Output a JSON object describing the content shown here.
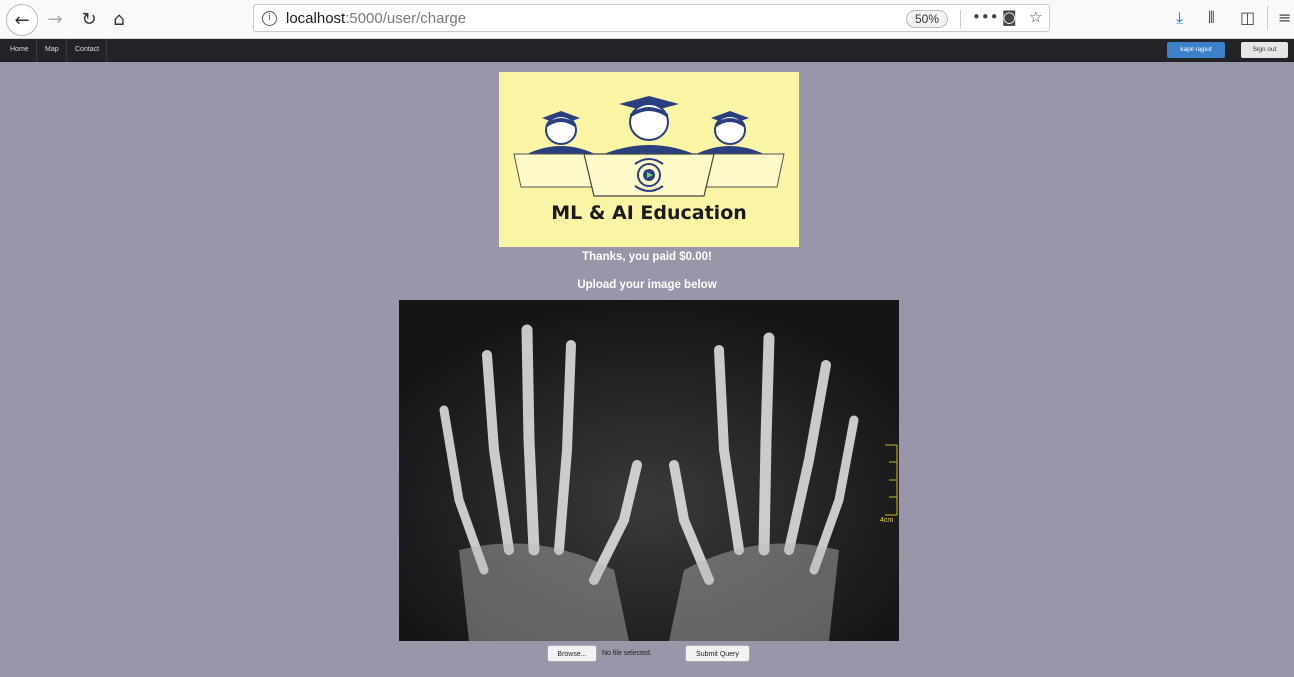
{
  "browser": {
    "url_host": "localhost",
    "url_path": ":5000/user/charge",
    "zoom": "50%"
  },
  "navbar": {
    "links": [
      "Home",
      "Map",
      "Contact"
    ],
    "user_label": "kapil rajput",
    "signout_label": "Sign out"
  },
  "logo": {
    "text": "ML & AI Education"
  },
  "payment_message": "Thanks, you paid $0.00!",
  "upload_prompt": "Upload your image below",
  "xray_scale_label": "4cm",
  "form": {
    "browse_label": "Browse...",
    "file_status": "No file selected.",
    "submit_label": "Submit Query"
  },
  "colors": {
    "page_bg": "#9a96a9",
    "navbar_bg": "#212327",
    "user_button": "#3b80c8",
    "logo_bg": "#faf5a5",
    "logo_navy": "#2a3f7f"
  }
}
